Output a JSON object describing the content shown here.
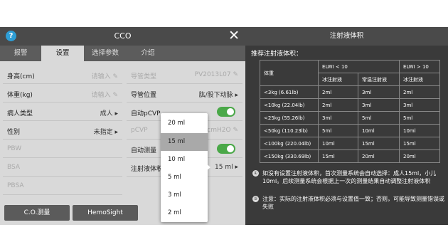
{
  "dialog": {
    "help_glyph": "?",
    "title": "CCO",
    "close_glyph": "✕",
    "tabs": [
      "报警",
      "设置",
      "选择参数",
      "介绍"
    ]
  },
  "left_fields": [
    {
      "label": "身高(cm)",
      "value": "请输入 ✎"
    },
    {
      "label": "体重(kg)",
      "value": "请输入 ✎"
    },
    {
      "label": "病人类型",
      "value": "成人 ▸"
    },
    {
      "label": "性别",
      "value": "未指定 ▸"
    },
    {
      "label": "PBW",
      "value": ""
    },
    {
      "label": "BSA",
      "value": ""
    },
    {
      "label": "PBSA",
      "value": ""
    }
  ],
  "right_fields": [
    {
      "label": "导管类型",
      "value": "PV2013L07 ✎"
    },
    {
      "label": "导管位置",
      "value": "肱/股下动脉 ▸"
    },
    {
      "label": "自动pCVP",
      "value": ""
    },
    {
      "label": "pCVP",
      "value": "5cmH2O ✎"
    },
    {
      "label": "自动测量",
      "value": ""
    },
    {
      "label": "注射液体积",
      "value": "15 ml ▸"
    }
  ],
  "buttons": {
    "co_measure": "C.O.测量",
    "hemosight": "HemoSight"
  },
  "dropdown_options": [
    "20 ml",
    "15 ml",
    "10 ml",
    "5 ml",
    "3 ml",
    "2 ml"
  ],
  "dropdown_selected": "15 ml",
  "right_panel": {
    "title": "注射液体积",
    "subtitle": "推荐注射液体积：",
    "table": {
      "header_weight": "体重",
      "header_elwi_low": "ELWI < 10",
      "header_elwi_high": "ELWI > 10",
      "sub_ice1": "冰注射液",
      "sub_room": "常温注射液",
      "sub_ice2": "冰注射液",
      "rows": [
        [
          "<3kg (6.61lb)",
          "2ml",
          "3ml",
          "2ml"
        ],
        [
          "<10kg (22.04lb)",
          "2ml",
          "3ml",
          "3ml"
        ],
        [
          "<25kg (55.26lb)",
          "3ml",
          "5ml",
          "5ml"
        ],
        [
          "<50kg (110.23lb)",
          "5ml",
          "10ml",
          "10ml"
        ],
        [
          "<100kg (220.04lb)",
          "10ml",
          "15ml",
          "15ml"
        ],
        [
          "<150kg (330.69lb)",
          "15ml",
          "20ml",
          "20ml"
        ]
      ]
    },
    "note1_num": "①",
    "note1": "如没有设置注射液体积，首次测量系统会自动选择：成人15ml，小儿10ml。后续测量系统会根据上一次的测量结果自动调整注射液体积",
    "note2_num": "②",
    "note2": "注意：实际的注射液体积必须与设置值一致；否则，可能导致测量错误或失败"
  }
}
